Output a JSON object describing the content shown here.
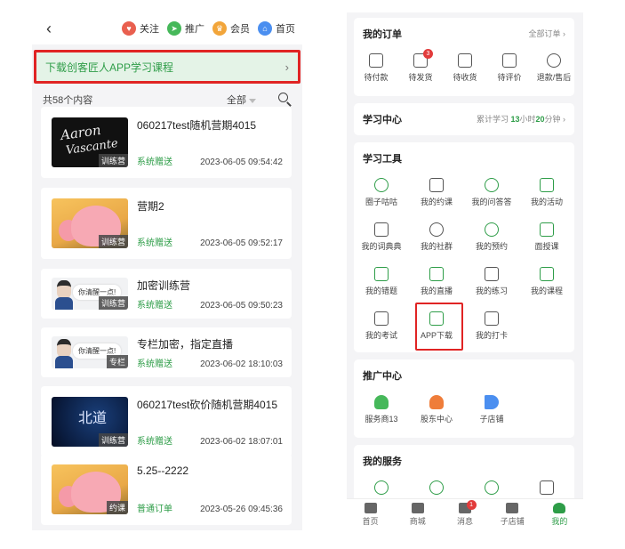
{
  "left": {
    "back_glyph": "‹",
    "topnav": [
      {
        "label": "关注",
        "icon": "heart-icon",
        "color": "#e95f4f",
        "glyph": "♥"
      },
      {
        "label": "推广",
        "icon": "send-icon",
        "color": "#46b85a",
        "glyph": "➤"
      },
      {
        "label": "会员",
        "icon": "crown-icon",
        "color": "#f2a53a",
        "glyph": "♛"
      },
      {
        "label": "首页",
        "icon": "home-icon",
        "color": "#4b8ff0",
        "glyph": "⌂"
      }
    ],
    "banner": {
      "text": "下载创客匠人APP学习课程",
      "chevron": "›"
    },
    "list_header": {
      "count": "共58个内容",
      "filter": "全部"
    },
    "items": [
      {
        "title": "060217test随机营期4015",
        "tag": "训练营",
        "source": "系统赠送",
        "date": "2023-06-05 09:54:42",
        "thumb": "dark",
        "thumb_text1": "Aaron",
        "thumb_text2": "Vascante"
      },
      {
        "title": "营期2",
        "tag": "训练营",
        "source": "系统赠送",
        "date": "2023-06-05 09:52:17",
        "thumb": "pig"
      },
      {
        "title": "加密训练营",
        "tag": "训练营",
        "source": "系统赠送",
        "date": "2023-06-05 09:50:23",
        "thumb": "avatar",
        "bubble": "你清醒一点!"
      },
      {
        "title": "专栏加密，指定直播",
        "tag": "专栏",
        "source": "系统赠送",
        "date": "2023-06-02 18:10:03",
        "thumb": "avatar",
        "bubble": "你清醒一点!"
      },
      {
        "title": "060217test砍价随机营期4015",
        "tag": "训练营",
        "source": "系统赠送",
        "date": "2023-06-02 18:07:01",
        "thumb": "night",
        "thumb_text1": "北道"
      },
      {
        "title": "5.25--2222",
        "tag": "约课",
        "source": "普通订单",
        "date": "2023-05-26 09:45:36",
        "thumb": "pig"
      }
    ]
  },
  "right": {
    "orders": {
      "title": "我的订单",
      "link": "全部订单 ›",
      "items": [
        {
          "label": "待付款",
          "icon": "wallet-icon"
        },
        {
          "label": "待发货",
          "icon": "package-icon",
          "badge": "3"
        },
        {
          "label": "待收货",
          "icon": "truck-icon"
        },
        {
          "label": "待评价",
          "icon": "comment-icon"
        },
        {
          "label": "退款/售后",
          "icon": "refund-icon"
        }
      ]
    },
    "study": {
      "title": "学习中心",
      "stat_prefix": "累计学习 ",
      "hours": "13",
      "hours_unit": "小时",
      "minutes": "20",
      "minutes_unit": "分钟 ›"
    },
    "tools": {
      "title": "学习工具",
      "items": [
        {
          "label": "圈子咕咕",
          "icon": "circle-chat-icon"
        },
        {
          "label": "我的约课",
          "icon": "calendar-clock-icon"
        },
        {
          "label": "我的问答答",
          "icon": "qa-icon"
        },
        {
          "label": "我的活动",
          "icon": "activity-icon"
        },
        {
          "label": "我的词典典",
          "icon": "book-icon"
        },
        {
          "label": "我的社群",
          "icon": "group-icon"
        },
        {
          "label": "我的预约",
          "icon": "clock-icon"
        },
        {
          "label": "面授课",
          "icon": "teacher-icon"
        },
        {
          "label": "我的错题",
          "icon": "wrong-question-icon"
        },
        {
          "label": "我的直播",
          "icon": "live-icon"
        },
        {
          "label": "我的练习",
          "icon": "practice-icon"
        },
        {
          "label": "我的课程",
          "icon": "course-icon"
        },
        {
          "label": "我的考试",
          "icon": "exam-icon"
        },
        {
          "label": "APP下载",
          "icon": "app-download-icon"
        },
        {
          "label": "我的打卡",
          "icon": "checkin-icon"
        }
      ]
    },
    "promo": {
      "title": "推广中心",
      "items": [
        {
          "label": "服务商13",
          "icon": "service-provider-icon",
          "color": "#46b85a"
        },
        {
          "label": "股东中心",
          "icon": "shareholder-icon",
          "color": "#ef7d3a"
        },
        {
          "label": "子店铺",
          "icon": "megaphone-icon",
          "color": "#4b8ff0"
        }
      ]
    },
    "services": {
      "title": "我的服务",
      "items": [
        {
          "icon": "target-icon"
        },
        {
          "icon": "eye-icon"
        },
        {
          "icon": "medal-icon"
        },
        {
          "icon": "graduation-cap-icon"
        }
      ]
    },
    "tabbar": [
      {
        "label": "首页",
        "icon": "home-tab-icon"
      },
      {
        "label": "商城",
        "icon": "mall-tab-icon"
      },
      {
        "label": "消息",
        "icon": "message-tab-icon",
        "badge": "1"
      },
      {
        "label": "子店铺",
        "icon": "shop-tab-icon"
      },
      {
        "label": "我的",
        "icon": "profile-tab-icon",
        "active": true
      }
    ]
  }
}
